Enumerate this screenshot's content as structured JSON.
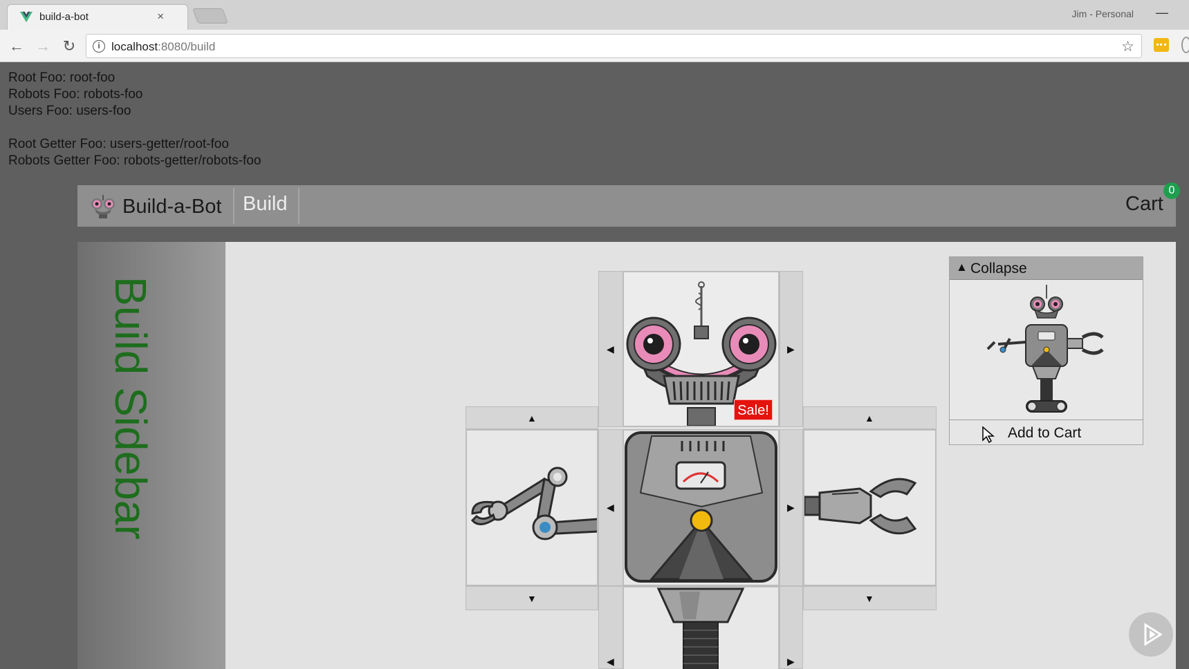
{
  "browser": {
    "tab_title": "build-a-bot",
    "tab_close": "×",
    "profile": "Jim - Personal",
    "minimize": "—",
    "url_host": "localhost",
    "url_path": ":8080/build",
    "back": "←",
    "forward": "→",
    "reload": "↻",
    "star": "☆",
    "info": "i"
  },
  "debug_lines": {
    "root_foo": "Root Foo: root-foo",
    "robots_foo": "Robots Foo: robots-foo",
    "users_foo": "Users Foo: users-foo",
    "root_getter_foo": "Root Getter Foo: users-getter/root-foo",
    "robots_getter_foo": "Robots Getter Foo: robots-getter/robots-foo"
  },
  "header": {
    "brand": "Build-a-Bot",
    "build_link": "Build",
    "cart_label": "Cart",
    "cart_count": "0"
  },
  "sidebar": {
    "text": "Build Sidebar"
  },
  "builder": {
    "sale_label": "Sale!",
    "arrow_up": "▲",
    "arrow_down": "▼",
    "arrow_left": "◀",
    "arrow_right": "▶"
  },
  "preview": {
    "collapse_arrow": "▲",
    "collapse_label": "Collapse",
    "add_to_cart": "Add to Cart"
  },
  "colors": {
    "sidebar_text": "#1d6d1d",
    "sale_badge": "#e4130d",
    "cart_badge": "#1f9f4e",
    "robot_eye_pink": "#e98bb8",
    "robot_accent_yellow": "#f2b90f"
  },
  "icons": {
    "tab_favicon": "vue-logo-icon",
    "player_overlay": "play-icon"
  }
}
